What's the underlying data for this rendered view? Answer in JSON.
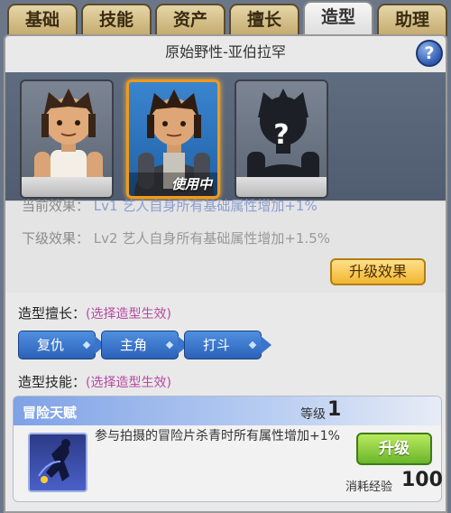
{
  "tabs": [
    {
      "label": "基础"
    },
    {
      "label": "技能"
    },
    {
      "label": "资产"
    },
    {
      "label": "擅长"
    },
    {
      "label": "造型",
      "active": true
    },
    {
      "label": "助理"
    }
  ],
  "panel": {
    "title": "原始野性-亚伯拉罕",
    "help_icon": "question-mark",
    "help_label": "?"
  },
  "portraits": [
    {
      "state": "owned"
    },
    {
      "state": "in-use",
      "badge": "使用中"
    },
    {
      "state": "locked",
      "placeholder": "?"
    }
  ],
  "effects": {
    "current_label": "当前效果：",
    "current_value": "Lv1 艺人自身所有基础属性增加+1%",
    "next_label": "下级效果：",
    "next_value": "Lv2 艺人自身所有基础属性增加+1.5%",
    "upgrade_button": "升级效果"
  },
  "specialty": {
    "label": "造型擅长：",
    "hint": "(选择造型生效)",
    "tags": [
      "复仇",
      "主角",
      "打斗"
    ]
  },
  "skill_section": {
    "label": "造型技能：",
    "hint": "(选择造型生效)"
  },
  "skill": {
    "name": "冒险天赋",
    "level_label": "等级",
    "level": "1",
    "description": "参与拍摄的冒险片杀青时所有属性增加+1%",
    "upgrade_button": "升级",
    "cost_label": "消耗经验",
    "cost_value": "100"
  },
  "colors": {
    "accent_gold": "#f1b630",
    "accent_blue": "#2b62b8",
    "upgrade_green": "#6ab52a",
    "hint_pink": "#b64aa3",
    "selected_border": "#f09a1a"
  }
}
